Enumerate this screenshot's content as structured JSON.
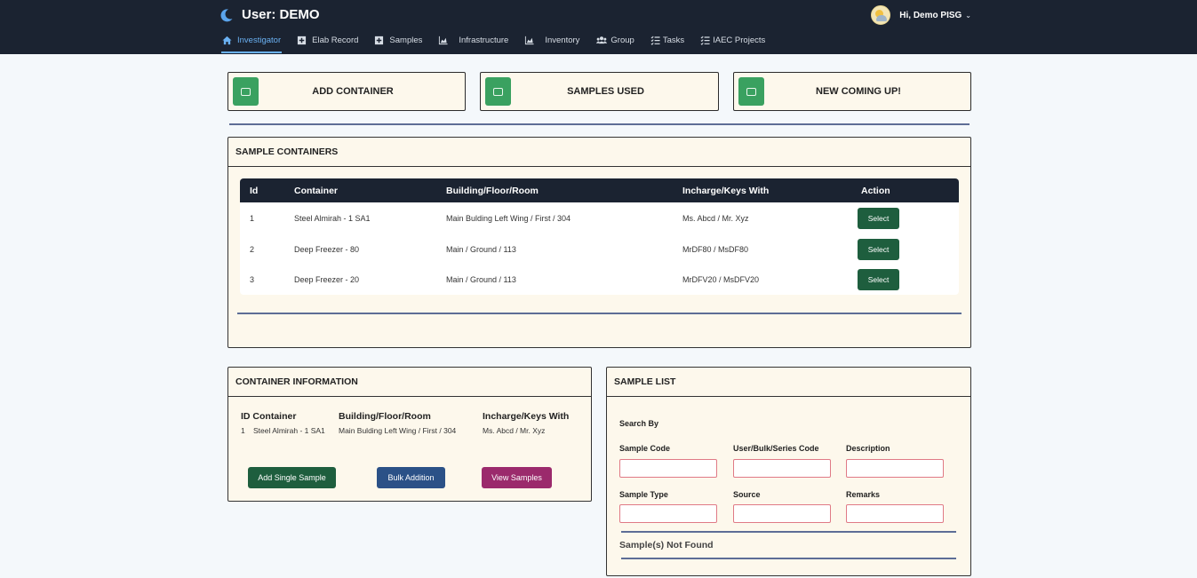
{
  "header": {
    "title": "User: DEMO",
    "greeting": "Hi, Demo PISG",
    "nav": [
      {
        "label": "Investigator",
        "icon": "home-icon",
        "active": true
      },
      {
        "label": "Elab Record",
        "icon": "plus-square-icon"
      },
      {
        "label": "Samples",
        "icon": "plus-square-icon"
      },
      {
        "label": "Infrastructure",
        "icon": "area-chart-icon"
      },
      {
        "label": "Inventory",
        "icon": "area-chart-icon"
      },
      {
        "label": "Group",
        "icon": "users-icon"
      },
      {
        "label": "Tasks",
        "icon": "tasks-icon"
      },
      {
        "label": "IAEC Projects",
        "icon": "tasks-icon"
      }
    ]
  },
  "actions": {
    "add_container": "ADD CONTAINER",
    "samples_used": "SAMPLES USED",
    "new_coming": "NEW COMING UP!"
  },
  "sample_containers": {
    "title": "SAMPLE CONTAINERS",
    "columns": [
      "Id",
      "Container",
      "Building/Floor/Room",
      "Incharge/Keys With",
      "Action"
    ],
    "rows": [
      {
        "id": "1",
        "container": "Steel Almirah - 1 SA1",
        "location": "Main Bulding Left Wing / First / 304",
        "incharge": "Ms. Abcd / Mr. Xyz",
        "action": "Select"
      },
      {
        "id": "2",
        "container": "Deep Freezer - 80",
        "location": "Main / Ground / 113",
        "incharge": "MrDF80 / MsDF80",
        "action": "Select"
      },
      {
        "id": "3",
        "container": "Deep Freezer - 20",
        "location": "Main / Ground / 113",
        "incharge": "MrDFV20 / MsDFV20",
        "action": "Select"
      }
    ]
  },
  "container_info": {
    "title": "CONTAINER INFORMATION",
    "h_id_container": "ID Container",
    "h_building": "Building/Floor/Room",
    "h_incharge": "Incharge/Keys With",
    "id": "1",
    "container": "Steel Almirah - 1 SA1",
    "building": "Main Bulding Left Wing / First / 304",
    "incharge": "Ms. Abcd / Mr. Xyz",
    "btn_add_single": "Add Single Sample",
    "btn_bulk": "Bulk Addition",
    "btn_view": "View Samples"
  },
  "sample_list": {
    "title": "SAMPLE LIST",
    "search_by": "Search By",
    "fields": {
      "sample_code": "Sample Code",
      "series_code": "User/Bulk/Series Code",
      "description": "Description",
      "sample_type": "Sample Type",
      "source": "Source",
      "remarks": "Remarks"
    },
    "not_found": "Sample(s) Not Found"
  },
  "colors": {
    "navbar": "#1b2331",
    "panel_bg": "#fdf8ec",
    "green": "#1e5e3e",
    "blue": "#2b5187",
    "magenta": "#9b2a6c",
    "active_nav": "#6ab1f3"
  }
}
